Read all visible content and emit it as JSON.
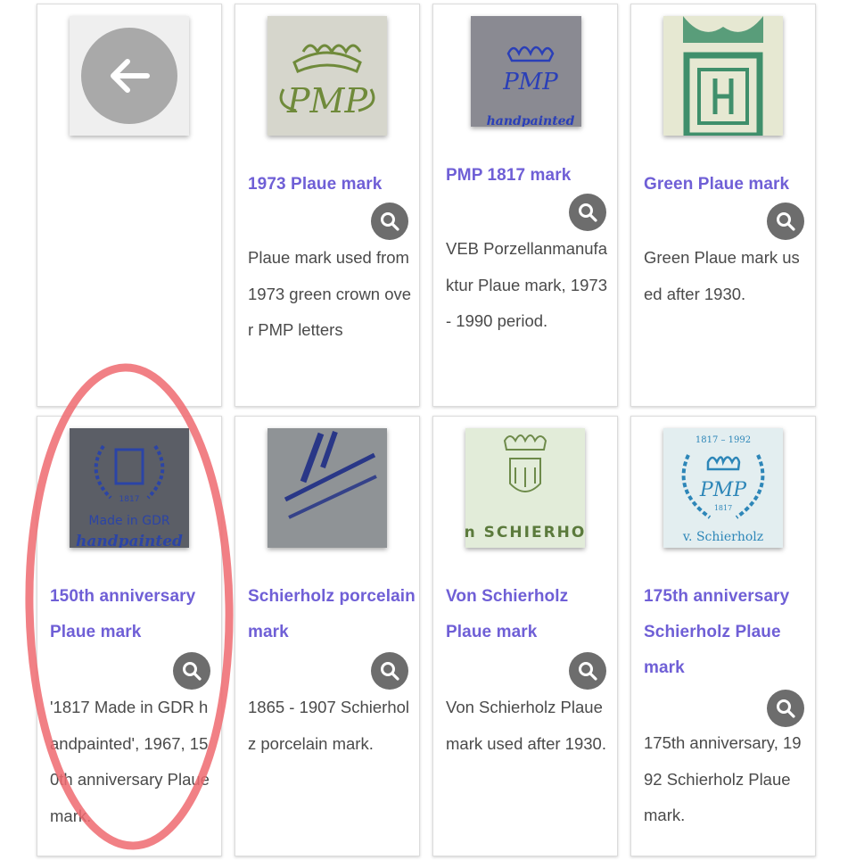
{
  "cards": [
    {
      "title": "",
      "description": "",
      "image": "back-arrow-tile"
    },
    {
      "title": "1973 Plaue mark",
      "description": "Plaue mark used from 1973 green crown over PMP letters",
      "image": "green-crown-pmp-mark"
    },
    {
      "title": "PMP 1817 mark",
      "description": "VEB Porzellanmanufaktur Plaue mark, 1973 - 1990 period.",
      "image": "blue-crown-pmp-handpainted-mark"
    },
    {
      "title": "Green Plaue mark",
      "description": "Green Plaue mark used after 1930.",
      "image": "green-crest-mark"
    },
    {
      "title": "150th anniversary Plaue mark",
      "description": "'1817 Made in GDR handpainted', 1967, 150th anniversary Plaue mark.",
      "image": "blue-wreath-gdr-mark",
      "thumb_text": [
        "1817",
        "Made in GDR",
        "handpainted"
      ]
    },
    {
      "title": "Schierholz porcelain mark",
      "description": "1865 - 1907 Schierholz porcelain mark.",
      "image": "blue-crossed-swords-mark"
    },
    {
      "title": "Von Schierholz Plaue mark",
      "description": "Von Schierholz Plaue mark used after 1930.",
      "image": "green-crown-shield-mark",
      "thumb_text": [
        "n SCHIERHO"
      ]
    },
    {
      "title": "175th anniversary Schierholz Plaue mark",
      "description": "175th anniversary, 1992 Schierholz Plaue mark.",
      "image": "blue-wreath-175-mark",
      "thumb_text": [
        "1817 – 1992",
        "1817",
        "v. Schierholz"
      ]
    }
  ],
  "thumb_text": {
    "mark_1973": [
      "PMP"
    ],
    "mark_1817": [
      "handpainted"
    ]
  },
  "icons": {
    "back": "left-arrow-icon",
    "zoom": "magnifier-icon"
  },
  "colors": {
    "title": "#6f5fd6",
    "text": "#4a4a4a",
    "zoom_bg": "#6d6d6d",
    "annotation": "#ef6a70"
  }
}
